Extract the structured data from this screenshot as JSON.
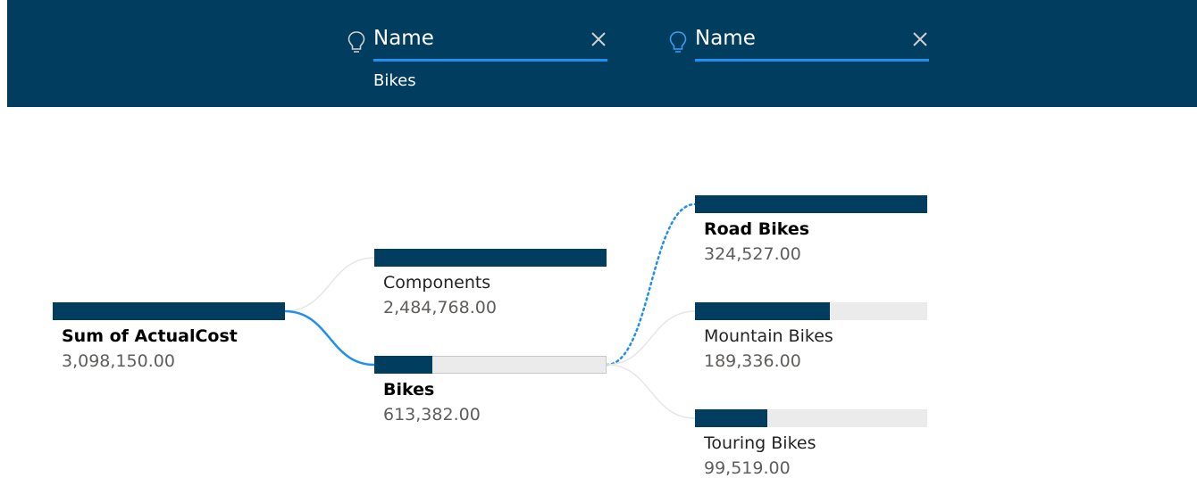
{
  "header": {
    "levels": [
      {
        "name": "Name",
        "selected": "Bikes",
        "icon": "lightbulb-icon",
        "icon_color": "#d0d0d0"
      },
      {
        "name": "Name",
        "selected": "",
        "icon": "lightbulb-icon",
        "icon_color": "#3b9cf0"
      }
    ],
    "close_icon": "close-icon"
  },
  "colors": {
    "header_bg": "#003d5e",
    "bar_fill": "#003d5e",
    "bar_track": "#ebebeb",
    "active_link": "#1f8ff0",
    "inactive_link": "#e6e6e6"
  },
  "chart_data": {
    "type": "decomposition-tree",
    "root": {
      "label": "Sum of ActualCost",
      "value_text": "3,098,150.00",
      "value": 3098150.0
    },
    "levels": [
      {
        "nodes": [
          {
            "label": "Components",
            "value_text": "2,484,768.00",
            "value": 2484768.0,
            "fill": 1.0,
            "selected": false
          },
          {
            "label": "Bikes",
            "value_text": "613,382.00",
            "value": 613382.0,
            "fill": 0.25,
            "selected": true
          }
        ]
      },
      {
        "nodes": [
          {
            "label": "Road Bikes",
            "value_text": "324,527.00",
            "value": 324527.0,
            "fill": 1.0,
            "selected": false,
            "highlighted": true
          },
          {
            "label": "Mountain Bikes",
            "value_text": "189,336.00",
            "value": 189336.0,
            "fill": 0.58,
            "selected": false
          },
          {
            "label": "Touring Bikes",
            "value_text": "99,519.00",
            "value": 99519.0,
            "fill": 0.31,
            "selected": false
          }
        ]
      }
    ]
  }
}
